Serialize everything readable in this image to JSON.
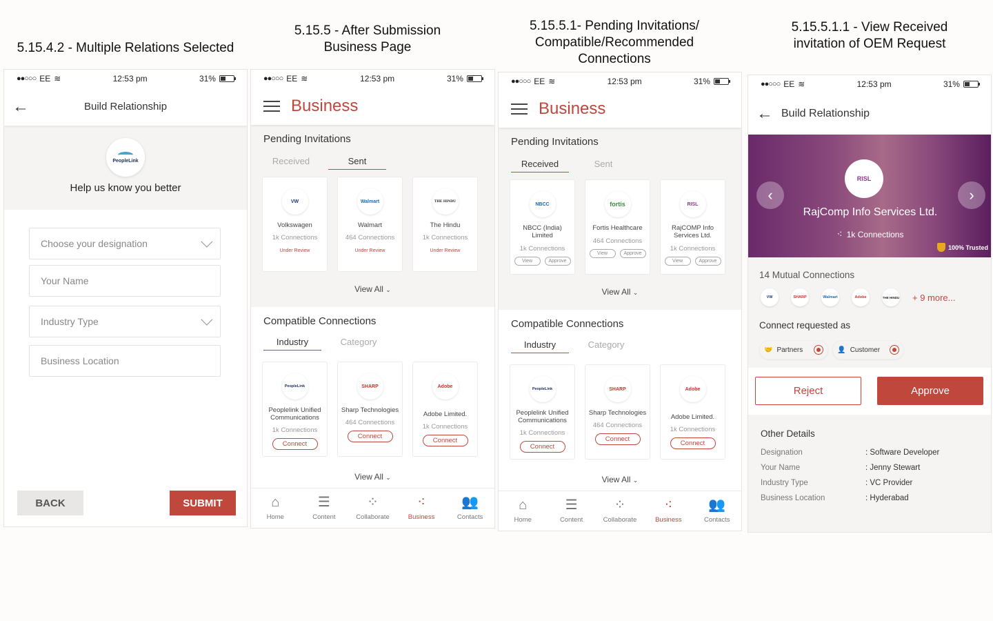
{
  "titles": {
    "s1": "5.15.4.2 - Multiple Relations Selected",
    "s2_line1": "5.15.5 - After Submission",
    "s2_line2": "Business Page",
    "s3_line1": "5.15.5.1- Pending Invitations/",
    "s3_line2": "Compatible/Recommended",
    "s3_line3": "Connections",
    "s4_line1": "5.15.5.1.1 - View Received",
    "s4_line2": "invitation of OEM Request"
  },
  "status": {
    "carrier": "EE",
    "time": "12:53 pm",
    "battery": "31%"
  },
  "screen1": {
    "header_title": "Build Relationship",
    "logo_text": "PeopleLink",
    "intro": "Help us know you better",
    "fields": {
      "designation": "Choose your designation",
      "name": "Your Name",
      "industry": "Industry Type",
      "location": "Business Location"
    },
    "back_label": "BACK",
    "submit_label": "SUBMIT"
  },
  "business": {
    "title": "Business",
    "pending_heading": "Pending Invitations",
    "tab_received": "Received",
    "tab_sent": "Sent",
    "compatible_heading": "Compatible Connections",
    "tab_industry": "Industry",
    "tab_category": "Category",
    "view_all": "View All",
    "sent_cards": [
      {
        "logo": "VW",
        "name": "Volkswagen",
        "connections": "1k Connections",
        "status": "Under Review"
      },
      {
        "logo": "Walmart",
        "name": "Walmart",
        "connections": "464 Connections",
        "status": "Under Review"
      },
      {
        "logo": "THE HINDU",
        "name": "The Hindu",
        "connections": "1k Connections",
        "status": "Under Review"
      }
    ],
    "received_cards": [
      {
        "logo": "NBCC",
        "name": "NBCC (India) Limited",
        "connections": "1k Connections"
      },
      {
        "logo": "fortis",
        "name": "Fortis Healthcare",
        "connections": "464 Connections"
      },
      {
        "logo": "RISL",
        "name": "RajCOMP Info Services Ltd.",
        "connections": "1k Connections"
      }
    ],
    "view_label": "View",
    "approve_label": "Approve",
    "compatible_cards": [
      {
        "logo": "PeopleLink",
        "name": "Peoplelink Unified Communications",
        "connections": "1k Connections"
      },
      {
        "logo": "SHARP",
        "name": "Sharp Technologies",
        "connections": "464 Connections"
      },
      {
        "logo": "Adobe",
        "name": "Adobe Limited.",
        "connections": "1k Connections"
      }
    ],
    "connect_label": "Connect",
    "nav": {
      "home": "Home",
      "content": "Content",
      "collaborate": "Collaborate",
      "business": "Business",
      "contacts": "Contacts"
    }
  },
  "screen4": {
    "header_title": "Build Relationship",
    "company": "RajComp Info Services Ltd.",
    "logo_text": "RISL",
    "connections": "1k Connections",
    "trusted": "100% Trusted",
    "mutual": "14 Mutual Connections",
    "mutual_logos": [
      "VW",
      "SHARP",
      "Walmart",
      "Adobe",
      "THE HINDU"
    ],
    "more": "+ 9 more...",
    "connect_requested": "Connect requested as",
    "role_partners": "Partners",
    "role_customer": "Customer",
    "reject_label": "Reject",
    "approve_label": "Approve",
    "other_details": "Other Details",
    "details": [
      {
        "k": "Designation",
        "v": ": Software Developer"
      },
      {
        "k": "Your Name",
        "v": ": Jenny Stewart"
      },
      {
        "k": "Industry Type",
        "v": ": VC Provider"
      },
      {
        "k": "Business Location",
        "v": ": Hyderabad"
      }
    ]
  },
  "colors": {
    "accent": "#c0473c",
    "muted": "#999999"
  }
}
